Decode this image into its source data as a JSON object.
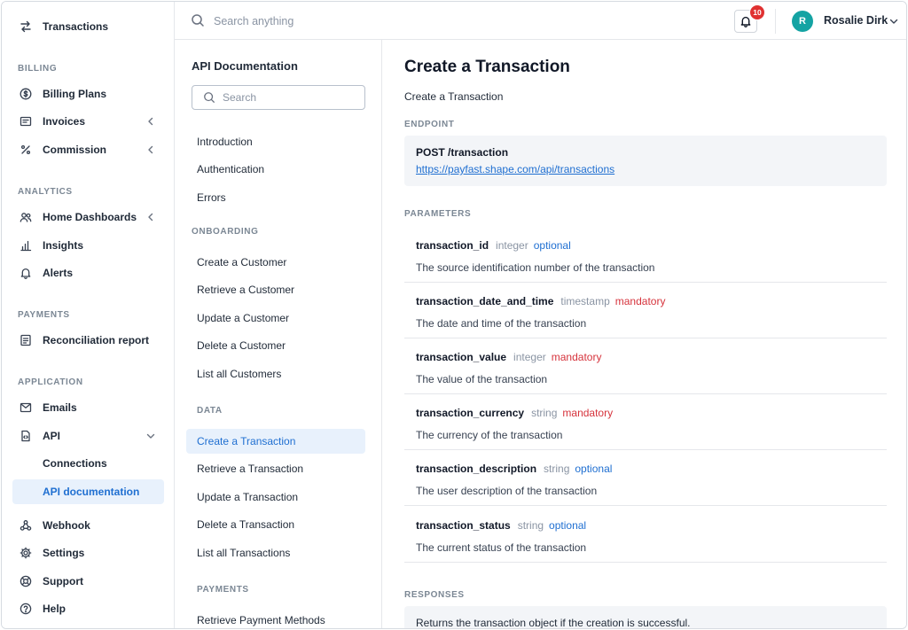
{
  "sidebar": {
    "top_item": {
      "label": "Transactions",
      "icon": "arrows-swap-icon"
    },
    "sections": {
      "billing": "BILLING",
      "analytics": "ANALYTICS",
      "payments": "PAYMENTS",
      "application": "APPLICATION"
    },
    "items": {
      "billing_plans": "Billing Plans",
      "invoices": "Invoices",
      "commission": "Commission",
      "home_dashboards": "Home Dashboards",
      "insights": "Insights",
      "alerts": "Alerts",
      "reconciliation_report": "Reconciliation report",
      "emails": "Emails",
      "api": "API",
      "connections": "Connections",
      "api_documentation": "API documentation",
      "webhook": "Webhook",
      "settings": "Settings",
      "support": "Support",
      "help": "Help"
    }
  },
  "topbar": {
    "search_placeholder": "Search anything",
    "notification_count": "10",
    "user_initial": "R",
    "user_name": "Rosalie Dirk"
  },
  "docnav": {
    "title": "API Documentation",
    "search_placeholder": "Search",
    "general": [
      "Introduction",
      "Authentication",
      "Errors"
    ],
    "onboarding_label": "ONBOARDING",
    "onboarding": [
      "Create a Customer",
      "Retrieve a Customer",
      "Update a Customer",
      "Delete a Customer",
      "List all Customers"
    ],
    "data_label": "DATA",
    "data": [
      "Create a Transaction",
      "Retrieve a Transaction",
      "Update a Transaction",
      "Delete a Transaction",
      "List all Transactions"
    ],
    "payments_label": "PAYMENTS",
    "payments": [
      "Retrieve Payment Methods"
    ]
  },
  "main": {
    "title": "Create a Transaction",
    "subtitle": "Create a Transaction",
    "endpoint_label": "ENDPOINT",
    "endpoint_method": "POST /transaction",
    "endpoint_url": "https://payfast.shape.com/api/transactions",
    "parameters_label": "PARAMETERS",
    "parameters": [
      {
        "name": "transaction_id",
        "type": "integer",
        "requirement": "optional",
        "description": "The source identification number of the transaction"
      },
      {
        "name": "transaction_date_and_time",
        "type": "timestamp",
        "requirement": "mandatory",
        "description": "The date and time of the transaction"
      },
      {
        "name": "transaction_value",
        "type": "integer",
        "requirement": "mandatory",
        "description": "The value of the transaction"
      },
      {
        "name": "transaction_currency",
        "type": "string",
        "requirement": "mandatory",
        "description": "The currency of the transaction"
      },
      {
        "name": "transaction_description",
        "type": "string",
        "requirement": "optional",
        "description": "The user description of the transaction"
      },
      {
        "name": "transaction_status",
        "type": "string",
        "requirement": "optional",
        "description": "The current status of the transaction"
      }
    ],
    "responses_label": "RESPONSES",
    "responses_text": "Returns the transaction object if the creation is successful."
  },
  "colors": {
    "accent": "#1f6fd1",
    "active_bg": "#e8f1fc",
    "mandatory": "#d6333c",
    "badge": "#e03131",
    "avatar": "#14a3a3"
  }
}
